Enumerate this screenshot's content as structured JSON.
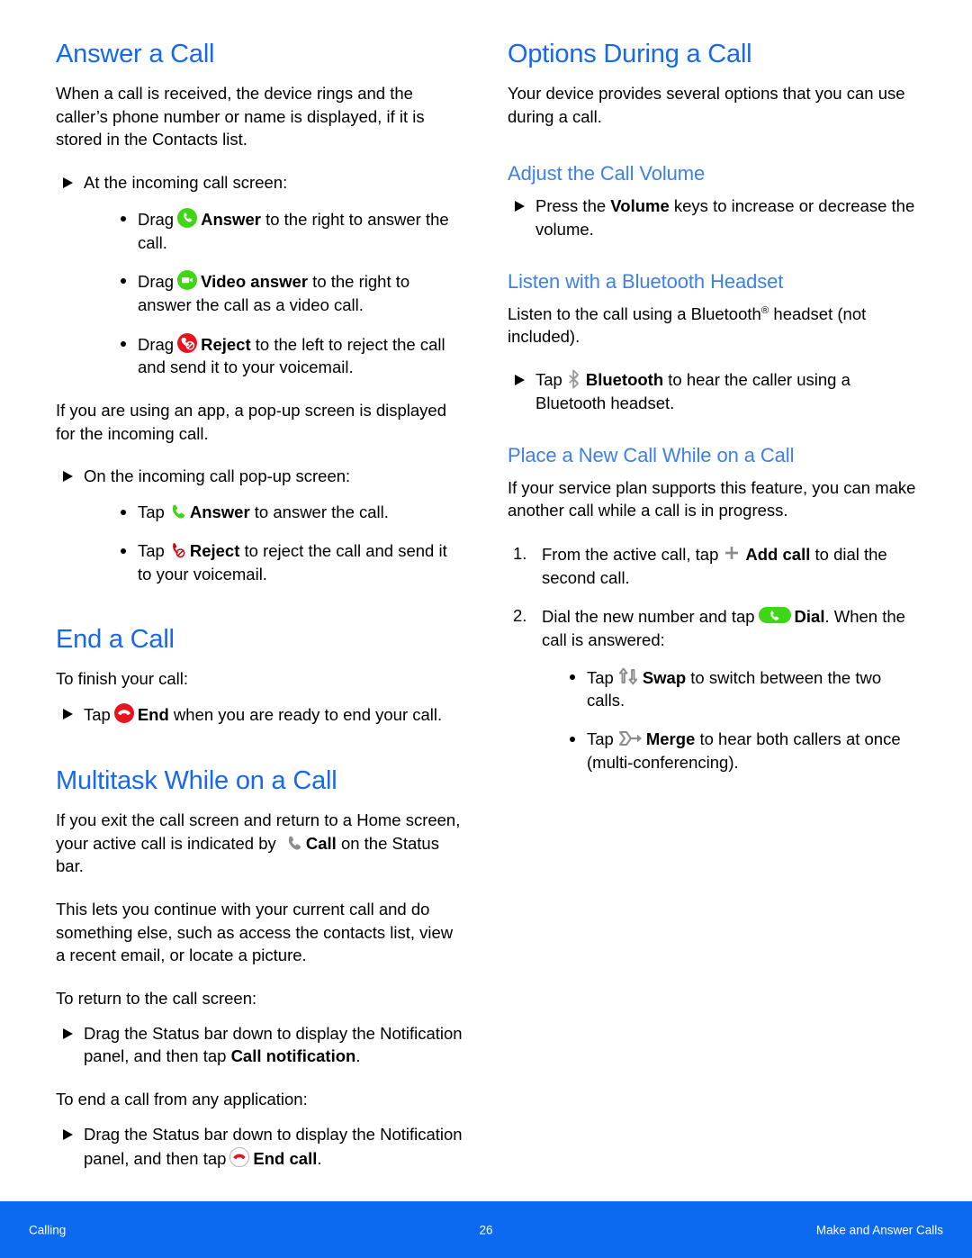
{
  "page": {
    "number": "26",
    "footer_left": "Calling",
    "footer_right": "Make and Answer Calls",
    "accent_heading_color": "#1668ee",
    "accent_subheading_color": "#3c80e8",
    "footer_bar_color": "#0b6aef"
  },
  "left_column": {
    "answer_a_call": {
      "title": "Answer a Call",
      "intro": "When a call is received, the device rings and the caller’s phone number or name is displayed, if it is stored in the Contacts list.",
      "incoming_screen_lead": "At the incoming call screen:",
      "incoming_screen_items": [
        {
          "pre": "Drag",
          "icon": "answer-circle-icon",
          "bold": "Answer",
          "post": " to the right to answer the call."
        },
        {
          "pre": "Drag",
          "icon": "video-answer-circle-icon",
          "bold": "Video answer",
          "post": " to the right to answer the call as a video call."
        },
        {
          "pre": "Drag",
          "icon": "reject-circle-icon",
          "bold": "Reject",
          "post": " to the left to reject the call and send it to your voicemail."
        }
      ],
      "popup_intro": "If you are using an app, a pop-up screen is displayed for the incoming call.",
      "popup_lead": "On the incoming call pop-up screen:",
      "popup_items": [
        {
          "pre": "Tap",
          "icon": "answer-handset-icon",
          "bold": "Answer",
          "post": " to answer the call."
        },
        {
          "pre": "Tap",
          "icon": "reject-handset-icon",
          "bold": "Reject",
          "post": " to reject the call and send it to your voicemail."
        }
      ]
    },
    "end_a_call": {
      "title": "End a Call",
      "lead": "To finish your call:",
      "item": {
        "pre": "Tap",
        "icon": "end-call-red-icon",
        "bold": "End",
        "post": " when you are ready to end your call."
      }
    },
    "multitask": {
      "title": "Multitask While on a Call",
      "para1_pre": "If you exit the call screen and return to a Home screen, your active call is indicated by ",
      "para1_icon": "call-status-handset-icon",
      "para1_bold": "Call",
      "para1_post": " on the Status bar.",
      "para2": "This lets you continue with your current call and do something else, such as access the contacts list, view a recent email, or locate a picture.",
      "return_lead": "To return to the call screen:",
      "return_item_pre": "Drag the Status bar down to display the Notification panel, and then tap ",
      "return_item_bold": "Call notification",
      "return_item_post": ".",
      "end_any_lead": "To end a call from any application:",
      "end_any_item_pre": "Drag the Status bar down to display the Notification panel, and then tap",
      "end_any_icon": "end-call-outline-icon",
      "end_any_bold": "End call",
      "end_any_post": "."
    }
  },
  "right_column": {
    "options_during_call": {
      "title": "Options During a Call",
      "intro": "Your device provides several options that you can use during a call."
    },
    "adjust_volume": {
      "title": "Adjust the Call Volume",
      "item_pre": "Press the ",
      "item_bold": "Volume",
      "item_post": " keys to increase or decrease the volume."
    },
    "bluetooth": {
      "title": "Listen with a Bluetooth Headset",
      "intro_pre": "Listen to the call using a Bluetooth",
      "intro_sup": "®",
      "intro_post": " headset (not included).",
      "item_pre": "Tap",
      "item_icon": "bluetooth-icon",
      "item_bold": "Bluetooth",
      "item_post": " to hear the caller using a Bluetooth headset."
    },
    "place_new_call": {
      "title": "Place a New Call While on a Call",
      "intro": "If your service plan supports this feature, you can make another call while a call is in progress.",
      "step1_pre": "From the active call, tap",
      "step1_icon": "add-call-plus-icon",
      "step1_bold": "Add call",
      "step1_post": " to dial the second call.",
      "step2_pre": "Dial the new number and tap",
      "step2_icon": "dial-pill-icon",
      "step2_bold": "Dial",
      "step2_post": ". When the call is answered:",
      "sub_items": [
        {
          "pre": "Tap",
          "icon": "swap-icon",
          "bold": "Swap",
          "post": " to switch between the two calls."
        },
        {
          "pre": "Tap",
          "icon": "merge-icon",
          "bold": "Merge",
          "post": " to hear both callers at once (multi-conferencing)."
        }
      ]
    }
  }
}
